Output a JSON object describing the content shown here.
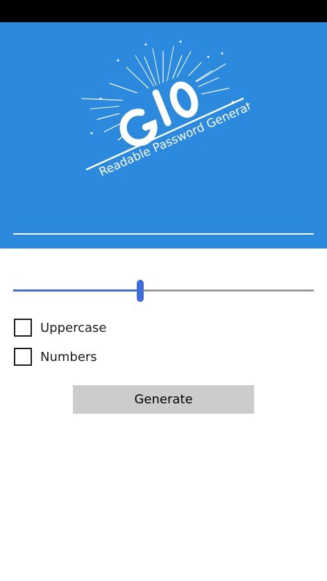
{
  "app": {
    "logo_text": "G10",
    "tagline": "Readable Password Generator"
  },
  "password": {
    "value": ""
  },
  "length_slider": {
    "level_fraction": 0.42
  },
  "options": [
    {
      "label": "Uppercase",
      "checked": false
    },
    {
      "label": "Numbers",
      "checked": false
    }
  ],
  "actions": {
    "generate_label": "Generate"
  },
  "colors": {
    "header": "#2b8ade",
    "accent": "#3d6be0",
    "track": "#9a9a9a",
    "button": "#cccccc"
  }
}
